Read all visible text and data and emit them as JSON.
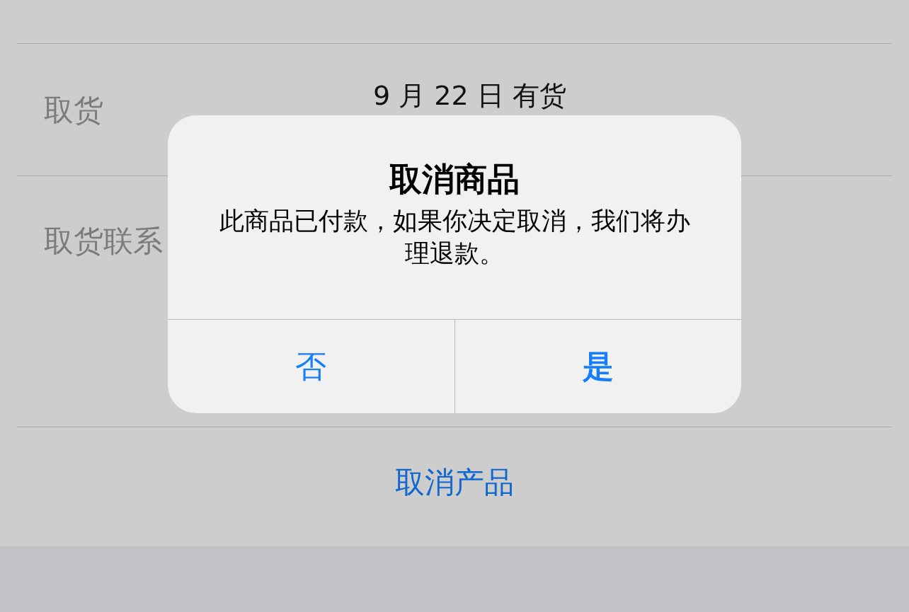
{
  "rows": [
    {
      "label": "取货",
      "value": "9 月 22 日 有货"
    },
    {
      "label": "取货联系"
    }
  ],
  "action": {
    "label": "取消产品"
  },
  "alert": {
    "title": "取消商品",
    "message": "此商品已付款，如果你决定取消，我们将办理退款。",
    "buttons": [
      {
        "label": "否",
        "kind": "cancel"
      },
      {
        "label": "是",
        "kind": "default"
      }
    ]
  }
}
